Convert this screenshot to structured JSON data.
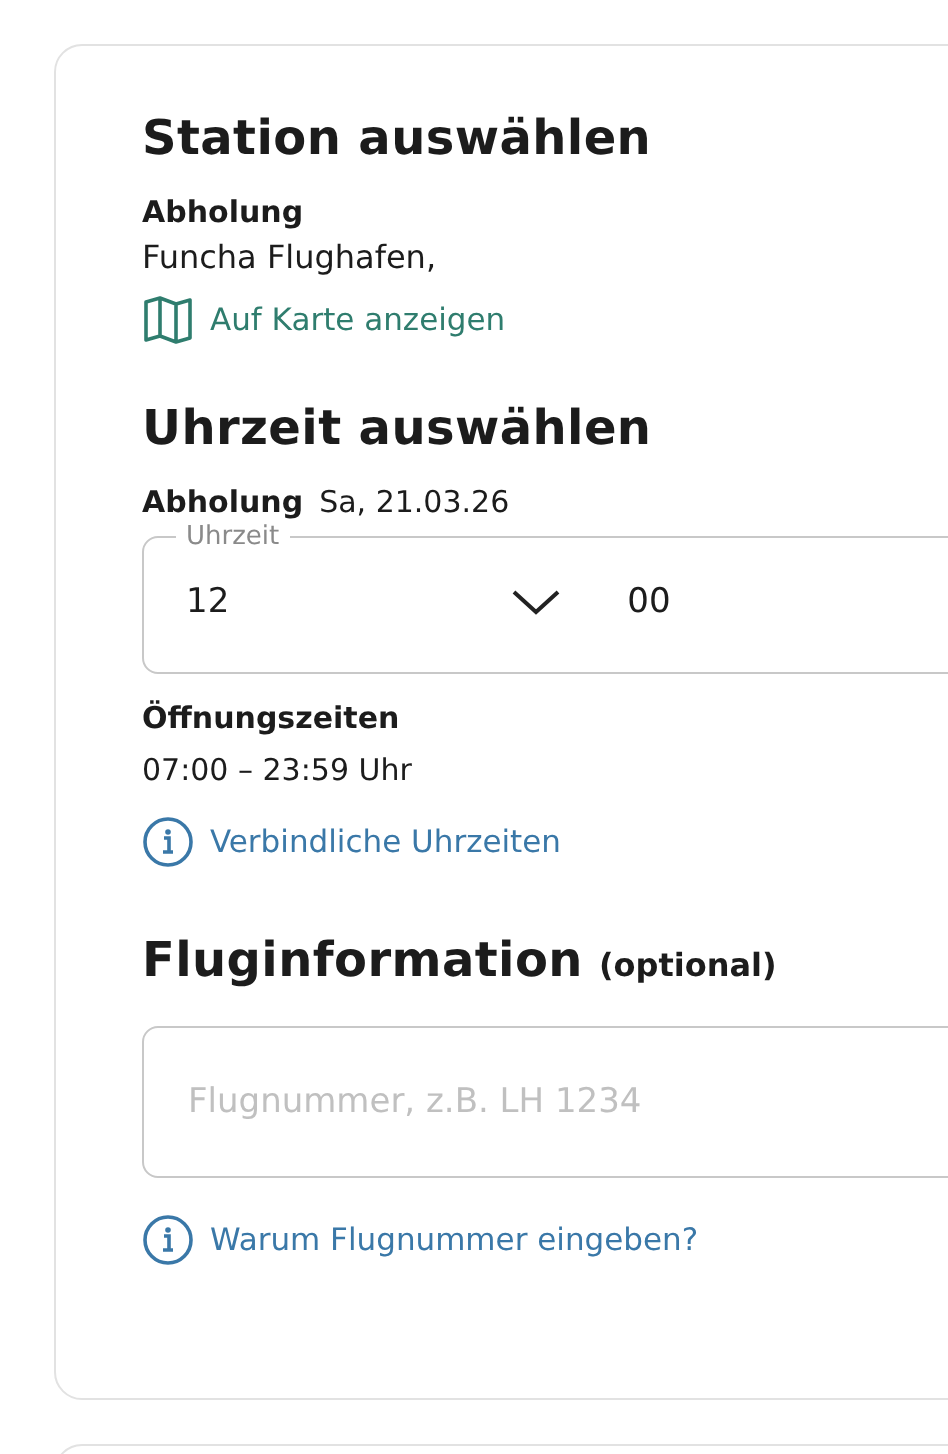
{
  "station": {
    "title": "Station auswählen",
    "pickup_label": "Abholung",
    "location": "Funcha Flughafen,",
    "map_link": "Auf Karte anzeigen"
  },
  "time": {
    "title": "Uhrzeit auswählen",
    "pickup_label": "Abholung",
    "date": "Sa, 21.03.26",
    "field_label": "Uhrzeit",
    "hour": "12",
    "minute": "00",
    "hours_label": "Öffnungszeiten",
    "hours": "07:00 – 23:59 Uhr",
    "info_link": "Verbindliche Uhrzeiten"
  },
  "flight": {
    "title": "Fluginformation",
    "title_note": "(optional)",
    "placeholder": "Flugnummer, z.B. LH 1234",
    "info_link": "Warum Flugnummer eingeben?"
  }
}
